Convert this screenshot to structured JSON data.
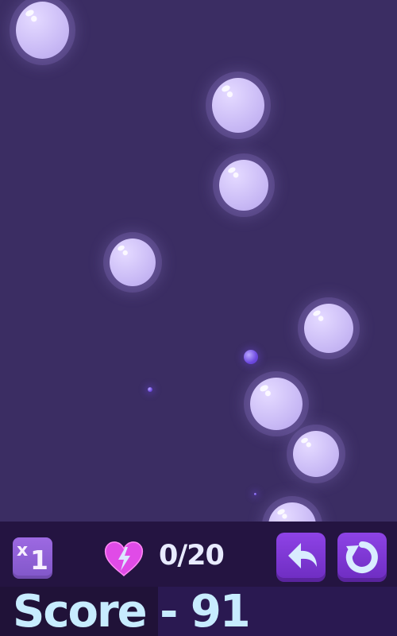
{
  "hud": {
    "multiplier_x": "x",
    "multiplier_value": "1",
    "progress_text": "0/20",
    "score_text": "Score - 91"
  },
  "icons": {
    "heart": "heart-lightning-icon",
    "undo": "undo-arrow-icon",
    "restart": "restart-icon"
  },
  "colors": {
    "background": "#3b2d63",
    "hud_background": "#22123d",
    "bubble": "#cbbcf6",
    "heart": "#e04be7",
    "button": "#7b33d2",
    "score_text": "#c7ecff"
  }
}
